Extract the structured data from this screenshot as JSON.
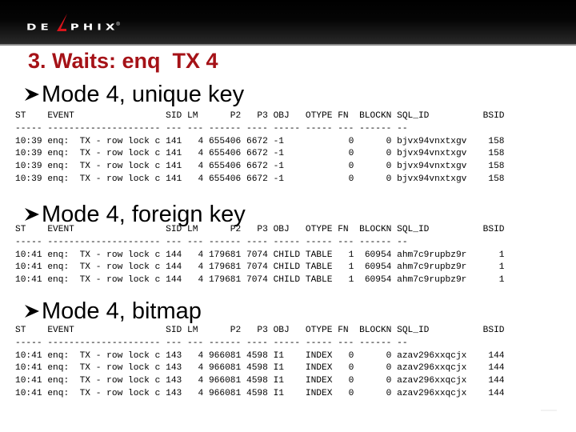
{
  "banner": {
    "logo_text_left": "DE",
    "logo_text_right": "PHIX",
    "logo_registered": "®",
    "logo_accent_color": "#d8141b"
  },
  "title": "3. Waits: enq  TX 4",
  "title_color": "#a51217",
  "sections": [
    {
      "heading": "Mode 4, unique key",
      "columns": [
        "ST",
        "EVENT",
        "SID",
        "LM",
        "P2",
        "P3",
        "OBJ",
        "OTYPE",
        "FN",
        "BLOCKN",
        "SQL_ID",
        "BSID"
      ],
      "separators": [
        "-----",
        "---------------------",
        "---",
        "---",
        "------",
        "----",
        "-----",
        "-----",
        "---",
        "------",
        "--",
        ""
      ],
      "rows": [
        [
          "10:39",
          "enq: TX - row lock c",
          "141",
          "4",
          "655406",
          "6672",
          "-1",
          "",
          "0",
          "0",
          "bjvx94vnxtxgv",
          "158"
        ],
        [
          "10:39",
          "enq: TX - row lock c",
          "141",
          "4",
          "655406",
          "6672",
          "-1",
          "",
          "0",
          "0",
          "bjvx94vnxtxgv",
          "158"
        ],
        [
          "10:39",
          "enq: TX - row lock c",
          "141",
          "4",
          "655406",
          "6672",
          "-1",
          "",
          "0",
          "0",
          "bjvx94vnxtxgv",
          "158"
        ],
        [
          "10:39",
          "enq: TX - row lock c",
          "141",
          "4",
          "655406",
          "6672",
          "-1",
          "",
          "0",
          "0",
          "bjvx94vnxtxgv",
          "158"
        ]
      ]
    },
    {
      "heading": "Mode 4, foreign key",
      "columns": [
        "ST",
        "EVENT",
        "SID",
        "LM",
        "P2",
        "P3",
        "OBJ",
        "OTYPE",
        "FN",
        "BLOCKN",
        "SQL_ID",
        "BSID"
      ],
      "separators": [
        "-----",
        "---------------------",
        "---",
        "---",
        "------",
        "----",
        "-----",
        "-----",
        "---",
        "------",
        "--",
        ""
      ],
      "rows": [
        [
          "10:41",
          "enq: TX - row lock c",
          "144",
          "4",
          "179681",
          "7074",
          "CHILD",
          "TABLE",
          "1",
          "60954",
          "ahm7c9rupbz9r",
          "1"
        ],
        [
          "10:41",
          "enq: TX - row lock c",
          "144",
          "4",
          "179681",
          "7074",
          "CHILD",
          "TABLE",
          "1",
          "60954",
          "ahm7c9rupbz9r",
          "1"
        ],
        [
          "10:41",
          "enq: TX - row lock c",
          "144",
          "4",
          "179681",
          "7074",
          "CHILD",
          "TABLE",
          "1",
          "60954",
          "ahm7c9rupbz9r",
          "1"
        ]
      ]
    },
    {
      "heading": "Mode 4, bitmap",
      "columns": [
        "ST",
        "EVENT",
        "SID",
        "LM",
        "P2",
        "P3",
        "OBJ",
        "OTYPE",
        "FN",
        "BLOCKN",
        "SQL_ID",
        "BSID"
      ],
      "separators": [
        "-----",
        "---------------------",
        "---",
        "---",
        "------",
        "----",
        "-----",
        "-----",
        "---",
        "------",
        "--",
        ""
      ],
      "rows": [
        [
          "10:41",
          "enq: TX - row lock c",
          "143",
          "4",
          "966081",
          "4598",
          "I1",
          "INDEX",
          "0",
          "0",
          "azav296xxqcjx",
          "144"
        ],
        [
          "10:41",
          "enq: TX - row lock c",
          "143",
          "4",
          "966081",
          "4598",
          "I1",
          "INDEX",
          "0",
          "0",
          "azav296xxqcjx",
          "144"
        ],
        [
          "10:41",
          "enq: TX - row lock c",
          "143",
          "4",
          "966081",
          "4598",
          "I1",
          "INDEX",
          "0",
          "0",
          "azav296xxqcjx",
          "144"
        ],
        [
          "10:41",
          "enq: TX - row lock c",
          "143",
          "4",
          "966081",
          "4598",
          "I1",
          "INDEX",
          "0",
          "0",
          "azav296xxqcjx",
          "144"
        ]
      ]
    }
  ]
}
